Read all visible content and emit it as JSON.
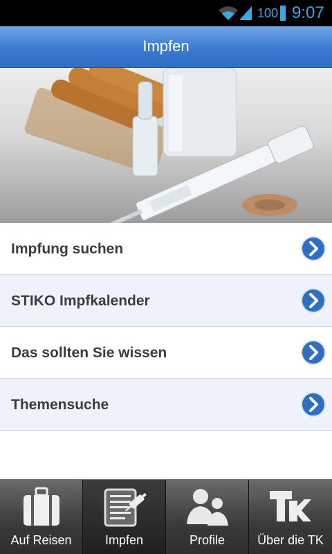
{
  "status_bar": {
    "battery": "100",
    "time": "9:07",
    "icons": [
      "wifi-icon",
      "signal-icon",
      "battery-icon"
    ]
  },
  "header": {
    "title": "Impfen"
  },
  "hero": {
    "image": "vaccine-ampoules-syringe-photo"
  },
  "menu": {
    "items": [
      {
        "label": "Impfung suchen",
        "icon": "chevron-right-icon"
      },
      {
        "label": "STIKO Impfkalender",
        "icon": "chevron-right-icon"
      },
      {
        "label": "Das sollten Sie wissen",
        "icon": "chevron-right-icon"
      },
      {
        "label": "Themensuche",
        "icon": "chevron-right-icon"
      }
    ]
  },
  "tabs": {
    "active": "Impfen",
    "items": [
      {
        "label": "Auf Reisen",
        "icon": "suitcase-icon"
      },
      {
        "label": "Impfen",
        "icon": "vaccination-card-icon"
      },
      {
        "label": "Profile",
        "icon": "profiles-icon"
      },
      {
        "label": "Über die TK",
        "icon": "tk-logo-icon"
      }
    ]
  },
  "colors": {
    "header": "#3b7bd0",
    "accent": "#3aa7e8",
    "chevron": "#2f6fc2",
    "row_alt": "#eef3fb"
  }
}
